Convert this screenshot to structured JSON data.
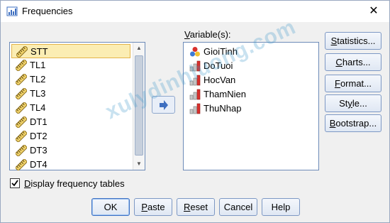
{
  "window": {
    "title": "Frequencies",
    "close_glyph": "✕"
  },
  "source_list": {
    "items": [
      {
        "label": "STT",
        "icon": "ruler-scale-icon",
        "selected": true
      },
      {
        "label": "TL1",
        "icon": "ruler-scale-icon"
      },
      {
        "label": "TL2",
        "icon": "ruler-scale-icon"
      },
      {
        "label": "TL3",
        "icon": "ruler-scale-icon"
      },
      {
        "label": "TL4",
        "icon": "ruler-scale-icon"
      },
      {
        "label": "DT1",
        "icon": "ruler-scale-icon"
      },
      {
        "label": "DT2",
        "icon": "ruler-scale-icon"
      },
      {
        "label": "DT3",
        "icon": "ruler-scale-icon"
      },
      {
        "label": "DT4",
        "icon": "ruler-scale-icon"
      }
    ]
  },
  "target": {
    "label_prefix": "V",
    "label_rest": "ariable(s):",
    "items": [
      {
        "label": "GioiTinh",
        "icon": "nominal-icon"
      },
      {
        "label": "DoTuoi",
        "icon": "ordinal-bar-icon"
      },
      {
        "label": "HocVan",
        "icon": "ordinal-bar-icon"
      },
      {
        "label": "ThamNien",
        "icon": "ordinal-bar-icon"
      },
      {
        "label": "ThuNhap",
        "icon": "ordinal-bar-icon"
      }
    ]
  },
  "side_buttons": [
    {
      "label": "Statistics...",
      "mnemonic": "S"
    },
    {
      "label": "Charts...",
      "mnemonic": "C"
    },
    {
      "label": "Format...",
      "mnemonic": "F"
    },
    {
      "label": "Style...",
      "mnemonic": "y"
    },
    {
      "label": "Bootstrap...",
      "mnemonic": "B"
    }
  ],
  "checkbox": {
    "label_prefix": "D",
    "label_rest": "isplay frequency tables",
    "checked": true
  },
  "bottom_buttons": [
    {
      "label": "OK",
      "default": true
    },
    {
      "label": "Paste",
      "mnemonic": "P"
    },
    {
      "label": "Reset",
      "mnemonic": "R"
    },
    {
      "label": "Cancel"
    },
    {
      "label": "Help"
    }
  ],
  "watermark": "xulydinhluong.com",
  "colors": {
    "accent": "#3f72c4",
    "selected_bg": "#fbedb3",
    "arrow": "#3e6fc0"
  }
}
